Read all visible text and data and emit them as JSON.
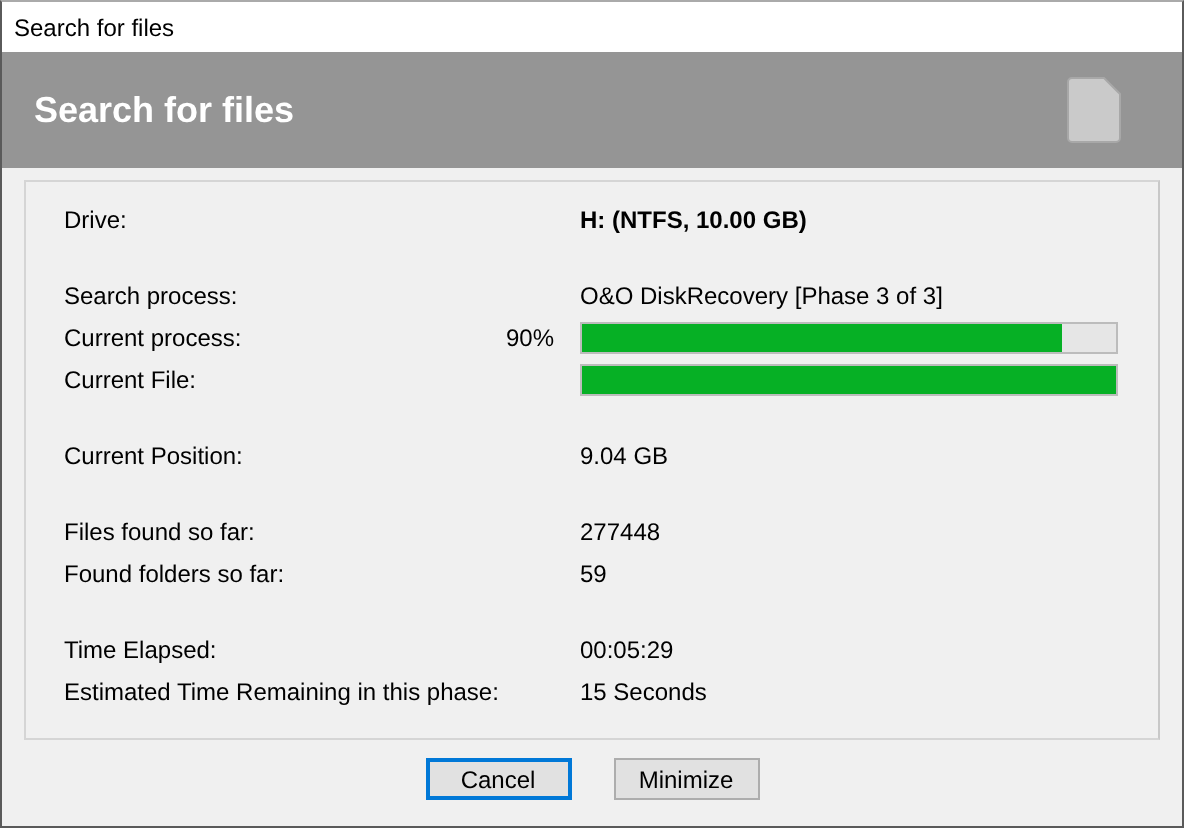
{
  "window": {
    "title": "Search for files"
  },
  "header": {
    "title": "Search for files"
  },
  "groups": [
    {
      "rows": [
        {
          "kind": "text",
          "label": "Drive:",
          "value": "H: (NTFS, 10.00 GB)",
          "bold": true
        }
      ]
    },
    {
      "rows": [
        {
          "kind": "text",
          "label": "Search process:",
          "value": "O&O DiskRecovery [Phase 3 of 3]",
          "bold": false
        },
        {
          "kind": "progress",
          "label": "Current process:",
          "reading": "90%",
          "level": 0.9
        },
        {
          "kind": "progress",
          "label": "Current File:",
          "level": 1.0
        }
      ]
    },
    {
      "rows": [
        {
          "kind": "text",
          "label": "Current Position:",
          "value": "9.04 GB",
          "bold": false
        }
      ]
    },
    {
      "rows": [
        {
          "kind": "text",
          "label": "Files found so far:",
          "value": "277448",
          "bold": false
        },
        {
          "kind": "text",
          "label": "Found folders so far:",
          "value": "59",
          "bold": false
        }
      ]
    },
    {
      "rows": [
        {
          "kind": "text",
          "label": "Time Elapsed:",
          "value": "00:05:29",
          "bold": false
        },
        {
          "kind": "text",
          "label": "Estimated Time Remaining in this phase:",
          "value": "15 Seconds",
          "bold": false
        }
      ]
    }
  ],
  "buttons": [
    {
      "label": "Cancel",
      "focused": true
    },
    {
      "label": "Minimize",
      "focused": false
    }
  ]
}
